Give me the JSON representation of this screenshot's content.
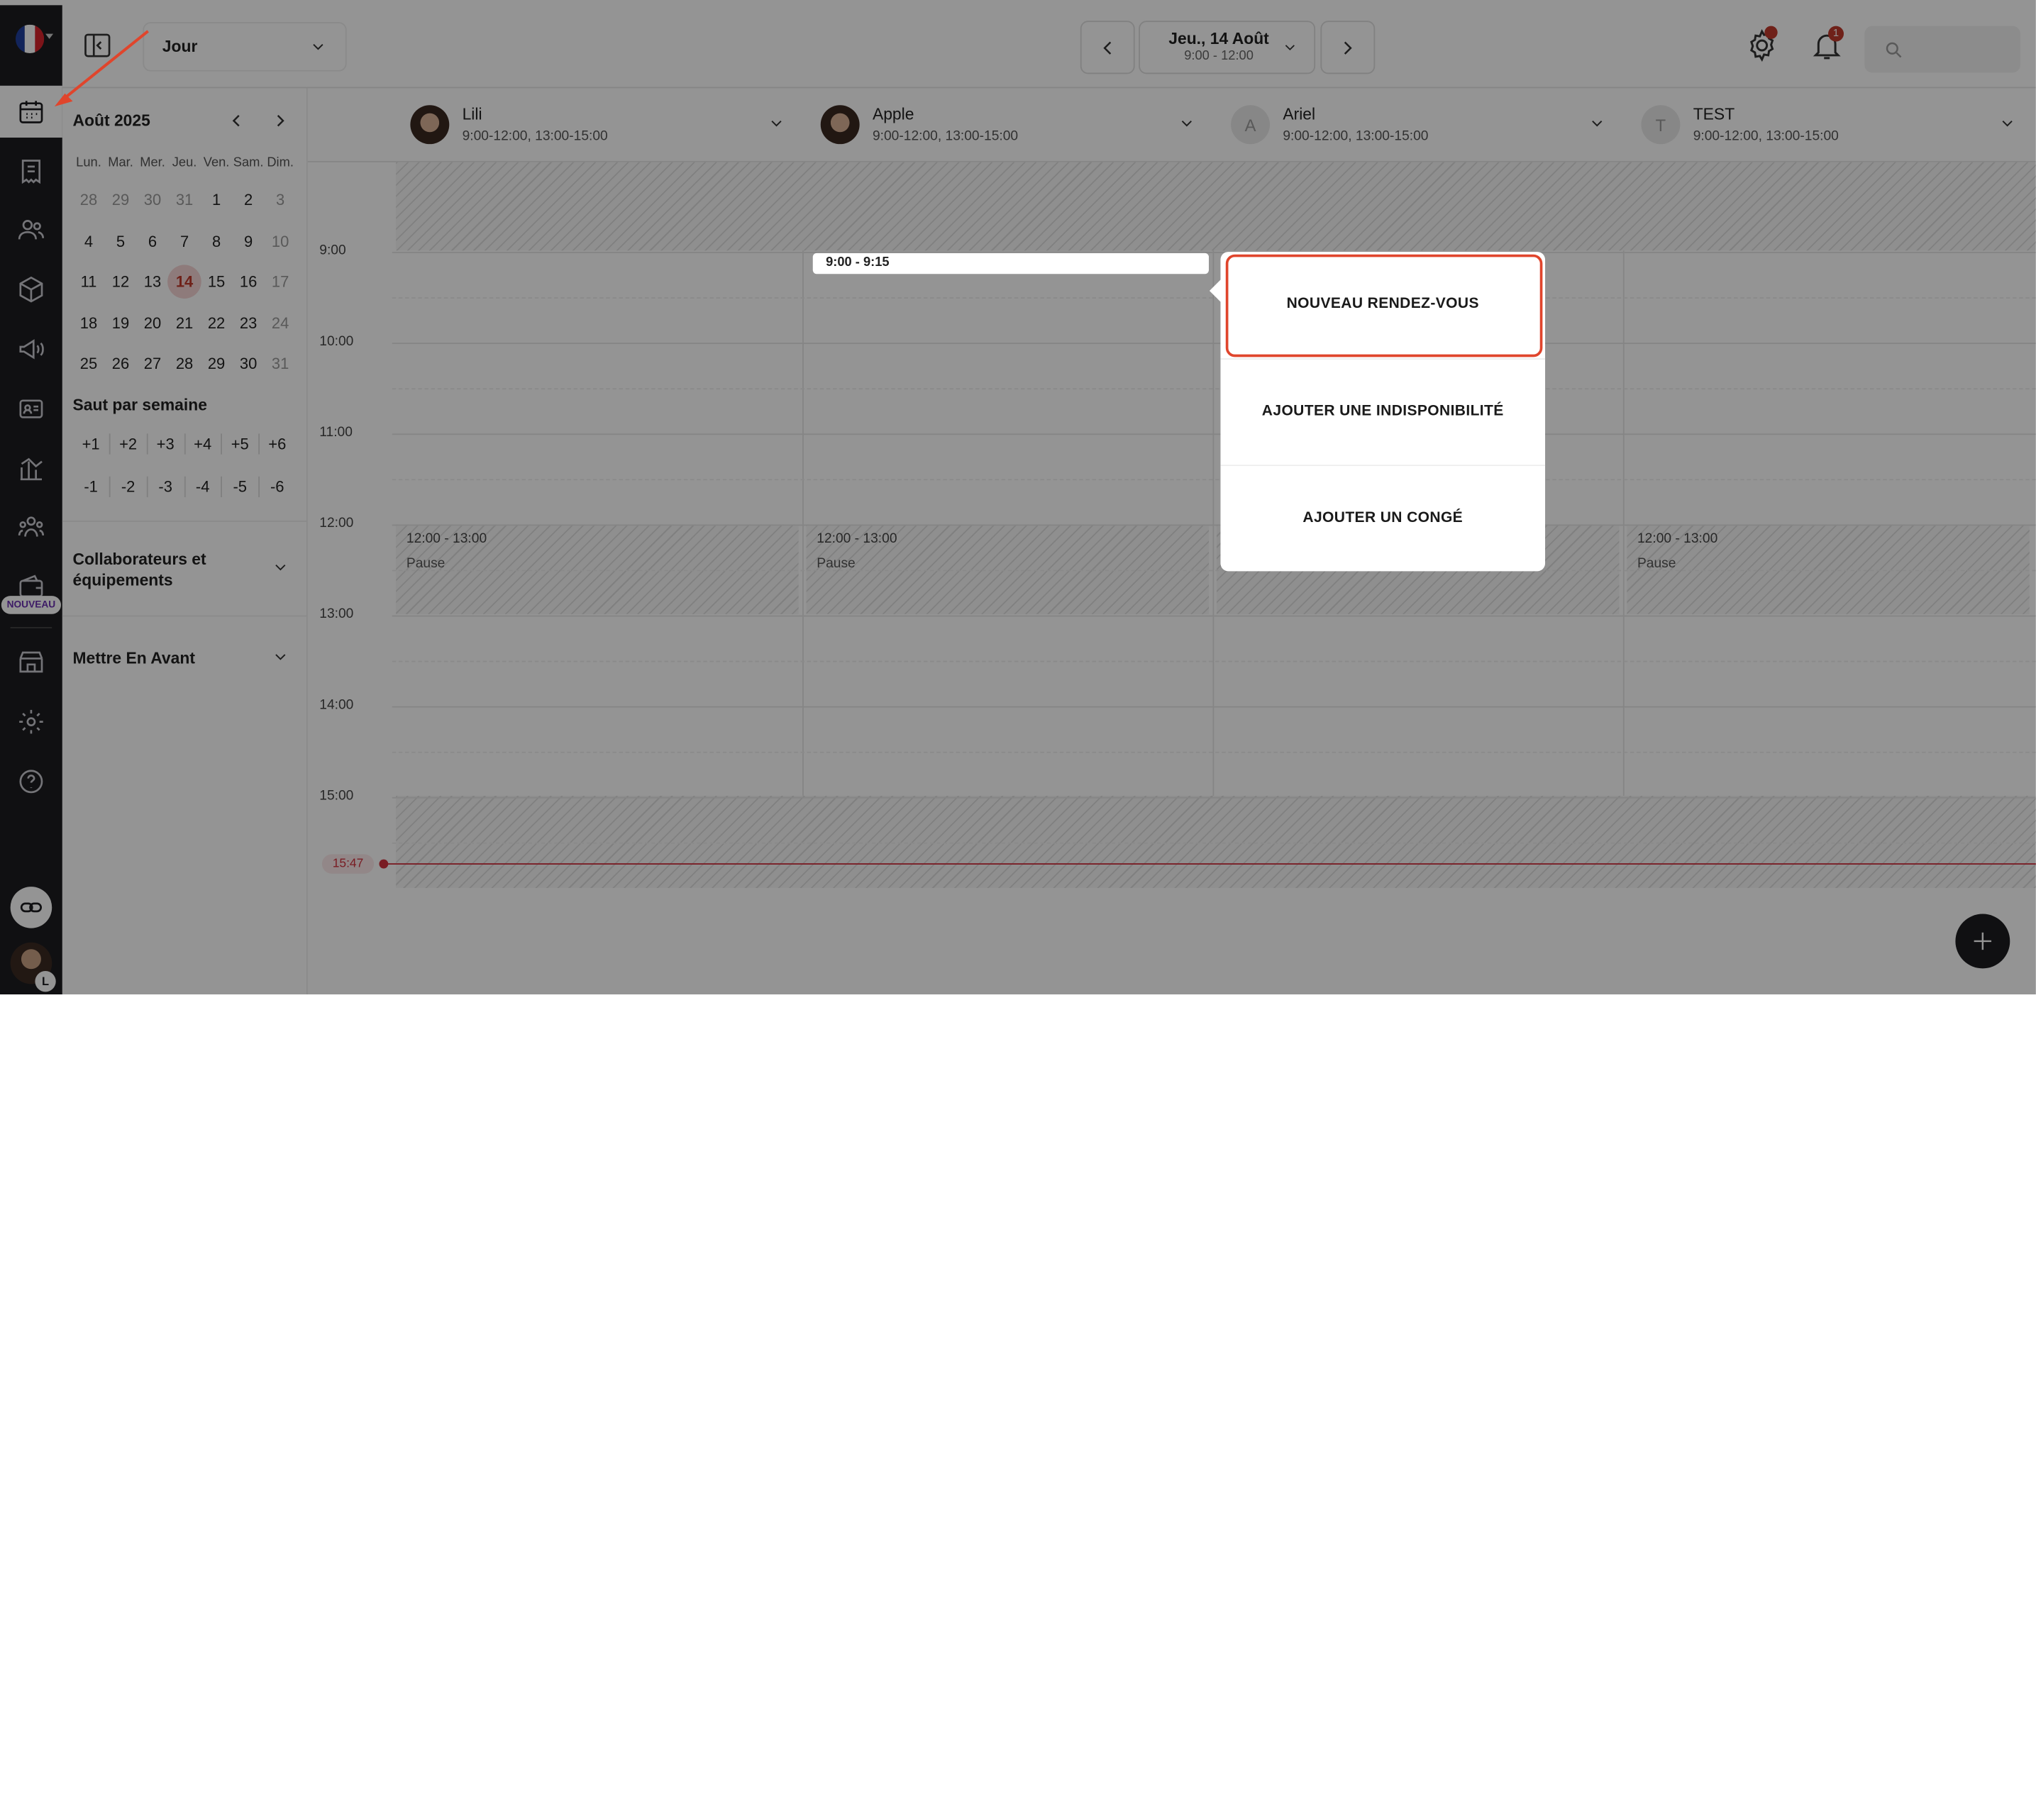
{
  "topbar": {
    "view_select": "Jour",
    "date_main": "Jeu., 14 Août",
    "date_sub": "9:00 - 12:00",
    "notification_count": "1",
    "search_placeholder": ""
  },
  "rail": {
    "badge_new": "NOUVEAU",
    "user_initial": "L",
    "items": [
      "calendar-icon",
      "receipt-icon",
      "clients-icon",
      "products-icon",
      "marketing-icon",
      "contact-card-icon",
      "stats-icon",
      "team-icon",
      "wallet-icon",
      "store-icon",
      "settings-icon",
      "help-icon"
    ]
  },
  "sidebar": {
    "month_title": "Août 2025",
    "weekdays": [
      "Lun.",
      "Mar.",
      "Mer.",
      "Jeu.",
      "Ven.",
      "Sam.",
      "Dim."
    ],
    "weeks": [
      [
        "28",
        "29",
        "30",
        "31",
        "1",
        "2",
        "3"
      ],
      [
        "4",
        "5",
        "6",
        "7",
        "8",
        "9",
        "10"
      ],
      [
        "11",
        "12",
        "13",
        "14",
        "15",
        "16",
        "17"
      ],
      [
        "18",
        "19",
        "20",
        "21",
        "22",
        "23",
        "24"
      ],
      [
        "25",
        "26",
        "27",
        "28",
        "29",
        "30",
        "31"
      ]
    ],
    "jump_title": "Saut par semaine",
    "jump_forward": [
      "+1",
      "+2",
      "+3",
      "+4",
      "+5",
      "+6"
    ],
    "jump_back": [
      "-1",
      "-2",
      "-3",
      "-4",
      "-5",
      "-6"
    ],
    "collab_title": "Collaborateurs et équipements",
    "featured_title": "Mettre En Avant"
  },
  "columns": [
    {
      "name": "Lili",
      "hours": "9:00-12:00, 13:00-15:00",
      "initial": ""
    },
    {
      "name": "Apple",
      "hours": "9:00-12:00, 13:00-15:00",
      "initial": ""
    },
    {
      "name": "Ariel",
      "hours": "9:00-12:00, 13:00-15:00",
      "initial": "A"
    },
    {
      "name": "TEST",
      "hours": "9:00-12:00, 13:00-15:00",
      "initial": "T"
    }
  ],
  "times": [
    "9:00",
    "10:00",
    "11:00",
    "12:00",
    "13:00",
    "14:00",
    "15:00"
  ],
  "current_time": "15:47",
  "pauses": [
    {
      "time": "12:00 - 13:00",
      "label": "Pause"
    },
    {
      "time": "12:00 - 13:00",
      "label": "Pause"
    },
    {
      "time": "12:00 - 13:00",
      "label": "Pause"
    }
  ],
  "slot_label": "9:00 - 9:15",
  "popup": {
    "new_appointment": "NOUVEAU RENDEZ-VOUS",
    "add_unavailability": "AJOUTER UNE INDISPONIBILITÉ",
    "add_leave": "AJOUTER UN CONGÉ"
  },
  "colors": {
    "accent": "#c0392b",
    "highlight": "#e0452c",
    "rail_bg": "#1c1c1f"
  }
}
